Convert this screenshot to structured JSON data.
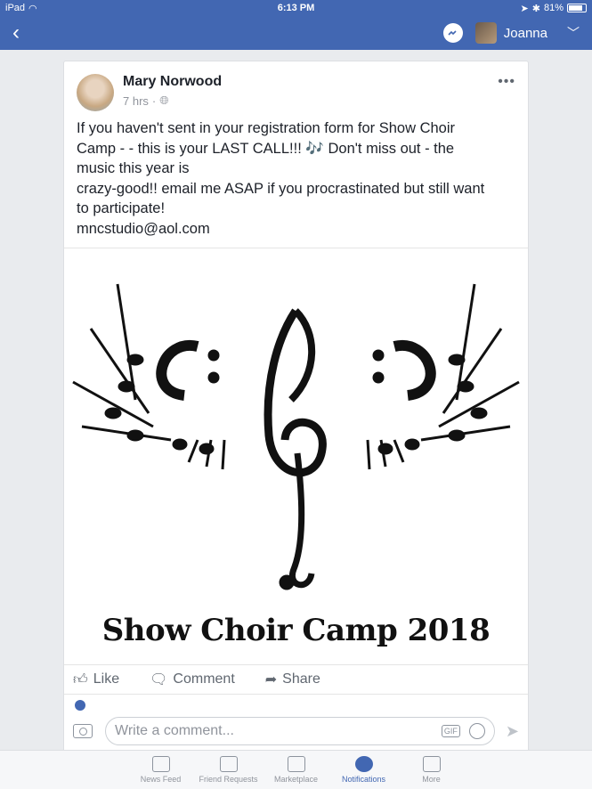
{
  "status_bar": {
    "device": "iPad",
    "time": "6:13 PM",
    "battery": "81%",
    "battery_level": 0.81
  },
  "nav": {
    "user_name": "Joanna"
  },
  "post": {
    "author": "Mary Norwood",
    "time": "7 hrs",
    "text_lines": [
      "If you haven't sent in your registration form for Show Choir",
      "Camp - - this is your LAST CALL!!!  🎶 Don't miss out - the",
      "music this year is",
      "crazy-good!! email me ASAP if you procrastinated but still want",
      "to participate!",
      "mncstudio@aol.com"
    ],
    "image_caption": "Show Choir Camp 2018"
  },
  "actions": {
    "like": "Like",
    "comment": "Comment",
    "share": "Share"
  },
  "comment": {
    "placeholder": "Write a comment...",
    "gif": "GIF"
  },
  "tabs": [
    {
      "label": "News Feed",
      "icon": "news-feed-icon"
    },
    {
      "label": "Friend Requests",
      "icon": "friend-requests-icon"
    },
    {
      "label": "Marketplace",
      "icon": "marketplace-icon"
    },
    {
      "label": "Notifications",
      "icon": "globe-icon",
      "active": true
    },
    {
      "label": "More",
      "icon": "menu-icon"
    }
  ],
  "colors": {
    "brand": "#4267b2",
    "text": "#1d2129",
    "muted": "#90949c"
  }
}
